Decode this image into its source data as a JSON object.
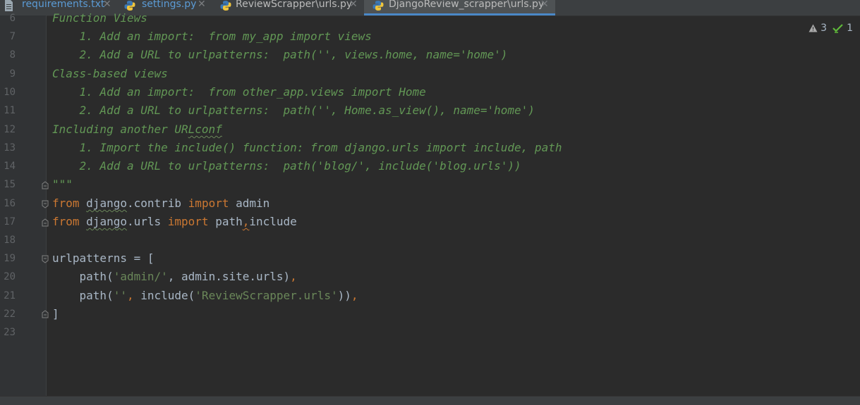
{
  "tabs": [
    {
      "label": "requirements.txt",
      "icon": "text-file-icon",
      "color": "#5b9bd5",
      "active": false
    },
    {
      "label": "settings.py",
      "icon": "python-file-icon",
      "color": "#5b9bd5",
      "active": false
    },
    {
      "label": "ReviewScrapper\\urls.py",
      "icon": "python-file-icon",
      "color": "#bbbbbb",
      "active": false
    },
    {
      "label": "DjangoReview_scrapper\\urls.py",
      "icon": "python-file-icon",
      "color": "#bbbbbb",
      "active": true
    }
  ],
  "close_glyph": "✕",
  "inspections": {
    "warnings": "3",
    "ok": "1"
  },
  "line_numbers": [
    "6",
    "7",
    "8",
    "9",
    "10",
    "11",
    "12",
    "13",
    "14",
    "15",
    "16",
    "17",
    "18",
    "19",
    "20",
    "21",
    "22",
    "23"
  ],
  "code": {
    "l6": "Function Views",
    "l7": "    1. Add an import:  from my_app import views",
    "l8": "    2. Add a URL to urlpatterns:  path('', views.home, name='home')",
    "l9": "Class-based views",
    "l10": "    1. Add an import:  from other_app.views import Home",
    "l11": "    2. Add a URL to urlpatterns:  path('', Home.as_view(), name='home')",
    "l12a": "Including another UR",
    "l12b": "Lconf",
    "l13": "    1. Import the include() function: from django.urls import include, path",
    "l14": "    2. Add a URL to urlpatterns:  path('blog/', include('blog.urls'))",
    "l15": "\"\"\"",
    "kw_from": "from",
    "kw_import": "import",
    "django": "django",
    "l16_mod": ".contrib ",
    "l16_name": " admin",
    "l17_mod": ".urls ",
    "l17_path": " path",
    "l17_comma": ",",
    "l17_inc": "include",
    "l19": "urlpatterns = [",
    "l20_a": "    path(",
    "l20_str": "'admin/'",
    "l20_b": ", admin.site.urls)",
    "l20_c": ",",
    "l21_a": "    path(",
    "l21_str1": "''",
    "l21_b": ", ",
    "l21_c": "include(",
    "l21_str2": "'ReviewScrapper.urls'",
    "l21_d": "))",
    "l21_e": ",",
    "l22": "]"
  },
  "colors": {
    "background": "#2b2b2b",
    "comment": "#629755",
    "keyword": "#cc7832",
    "string": "#6a8759",
    "text": "#a9b7c6",
    "accent": "#4a88c7"
  }
}
